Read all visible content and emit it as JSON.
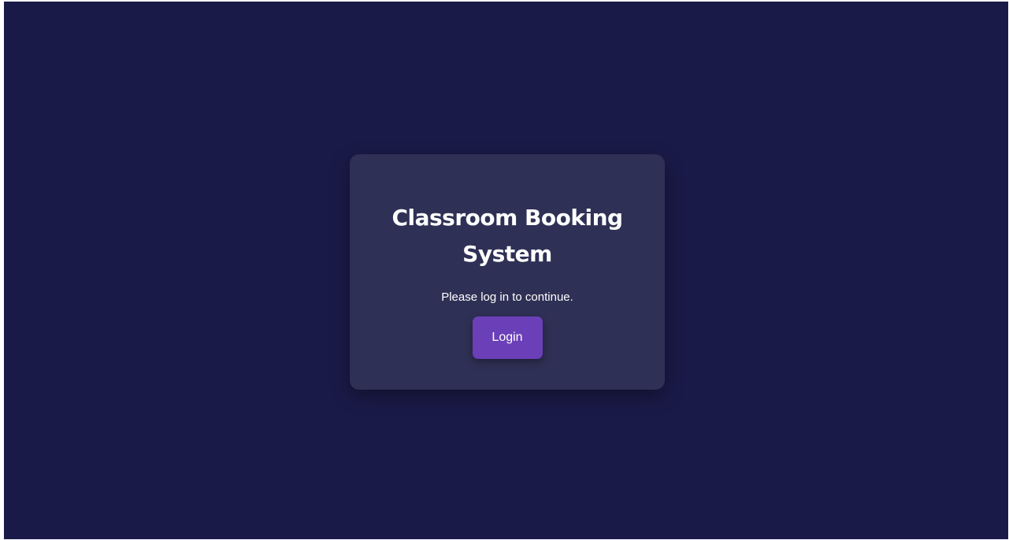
{
  "login_card": {
    "title": "Classroom Booking System",
    "subtitle": "Please log in to continue.",
    "login_label": "Login"
  },
  "colors": {
    "page_background": "#1a1a48",
    "card_background": "#2f3055",
    "button_background": "#6a3fb8",
    "text": "#ffffff"
  }
}
